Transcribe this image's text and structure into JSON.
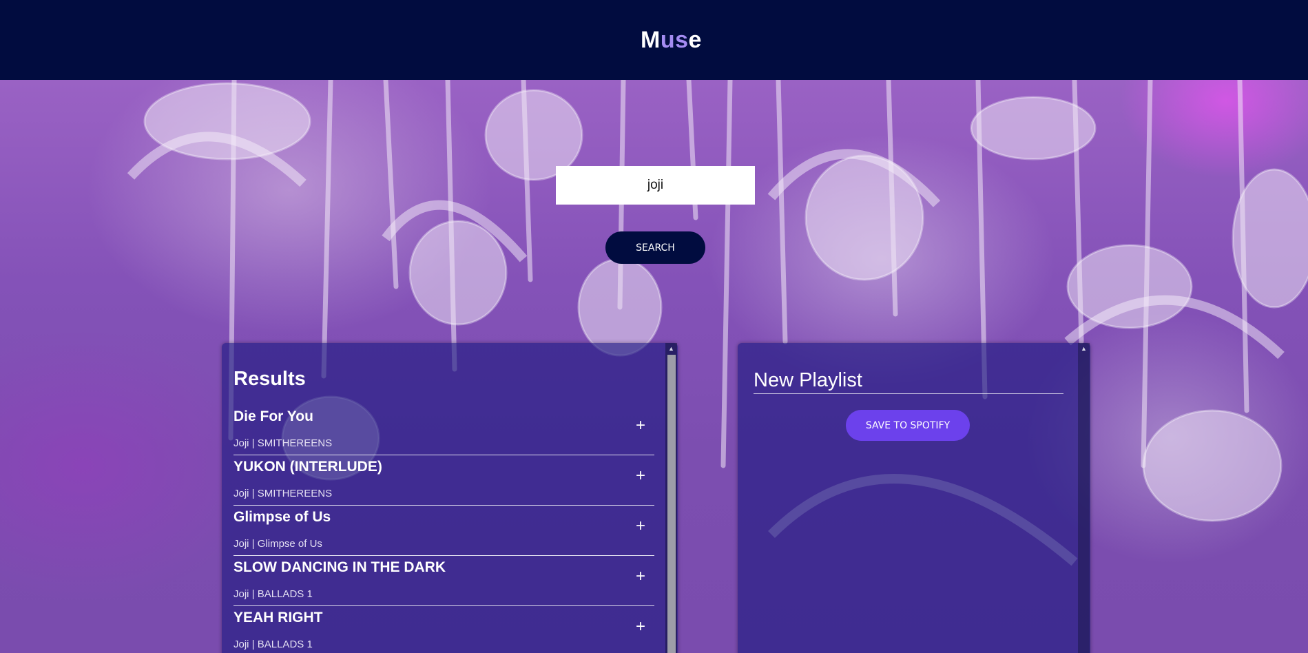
{
  "header": {
    "logo_prefix": "M",
    "logo_accent": "us",
    "logo_suffix": "e"
  },
  "search": {
    "value": "joji",
    "button_label": "SEARCH"
  },
  "results": {
    "title": "Results",
    "add_symbol": "+",
    "tracks": [
      {
        "name": "Die For You",
        "meta": "Joji | SMITHEREENS"
      },
      {
        "name": "YUKON (INTERLUDE)",
        "meta": "Joji | SMITHEREENS"
      },
      {
        "name": "Glimpse of Us",
        "meta": "Joji | Glimpse of Us"
      },
      {
        "name": "SLOW DANCING IN THE DARK",
        "meta": "Joji | BALLADS 1"
      },
      {
        "name": "YEAH RIGHT",
        "meta": "Joji | BALLADS 1"
      }
    ]
  },
  "playlist": {
    "name": "New Playlist",
    "save_label": "SAVE TO SPOTIFY"
  },
  "colors": {
    "header_bg": "#010c3f",
    "logo_accent": "#a48cf2",
    "save_button": "#6c41ec",
    "search_button": "#010c3f"
  }
}
